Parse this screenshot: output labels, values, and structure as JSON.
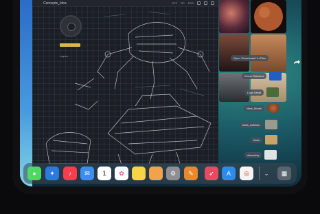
{
  "app": {
    "title": "Concepts_Idea",
    "toolbar_text": [
      "OFF",
      "RP",
      "PRS"
    ],
    "layers_label": "Layers"
  },
  "drag_stack": {
    "pill_photos_to_files": "Open “Downloads” in Files",
    "items": [
      {
        "label": "Drone Sketches",
        "thumb_color": "#1e5fbf"
      },
      {
        "label": "Logo Detail",
        "thumb_color": "#4a6b3a"
      },
      {
        "label": "Mars_Model",
        "thumb_color": "#b55a2c"
      },
      {
        "label": "Mars_Detritus",
        "thumb_color": "#9a9a8e"
      },
      {
        "label": "Mars",
        "thumb_color": "#c9a36a"
      },
      {
        "label": "Assembly",
        "thumb_color": "#dfe3e6"
      }
    ]
  },
  "dock": {
    "apps": [
      {
        "name": "Messages",
        "color": "#4cd964",
        "glyph": "💬"
      },
      {
        "name": "Safari",
        "color": "#2a7ae2",
        "glyph": "🧭"
      },
      {
        "name": "Music",
        "color": "#fa3c4c",
        "glyph": "♪"
      },
      {
        "name": "Mail",
        "color": "#3b8ef0",
        "glyph": "✉"
      },
      {
        "name": "Calendar",
        "color": "#ffffff",
        "glyph": "1"
      },
      {
        "name": "Photos",
        "color": "#ffffff",
        "glyph": "✿"
      },
      {
        "name": "Notes",
        "color": "#f6d547",
        "glyph": ""
      },
      {
        "name": "Files",
        "color": "#f0a34a",
        "glyph": ""
      },
      {
        "name": "Settings",
        "color": "#8e8e93",
        "glyph": "⚙"
      },
      {
        "name": "Pencil App",
        "color": "#e8892b",
        "glyph": "✎"
      },
      {
        "name": "Shortcuts",
        "color": "#e84a5f",
        "glyph": "✈"
      },
      {
        "name": "App Store",
        "color": "#2a8cf0",
        "glyph": "A"
      },
      {
        "name": "Chrome",
        "color": "#f4f4f4",
        "glyph": "◎"
      },
      {
        "name": "Chevron",
        "color": "transparent",
        "glyph": "⌄"
      },
      {
        "name": "App Library",
        "color": "#5a6470",
        "glyph": "▦"
      }
    ]
  }
}
